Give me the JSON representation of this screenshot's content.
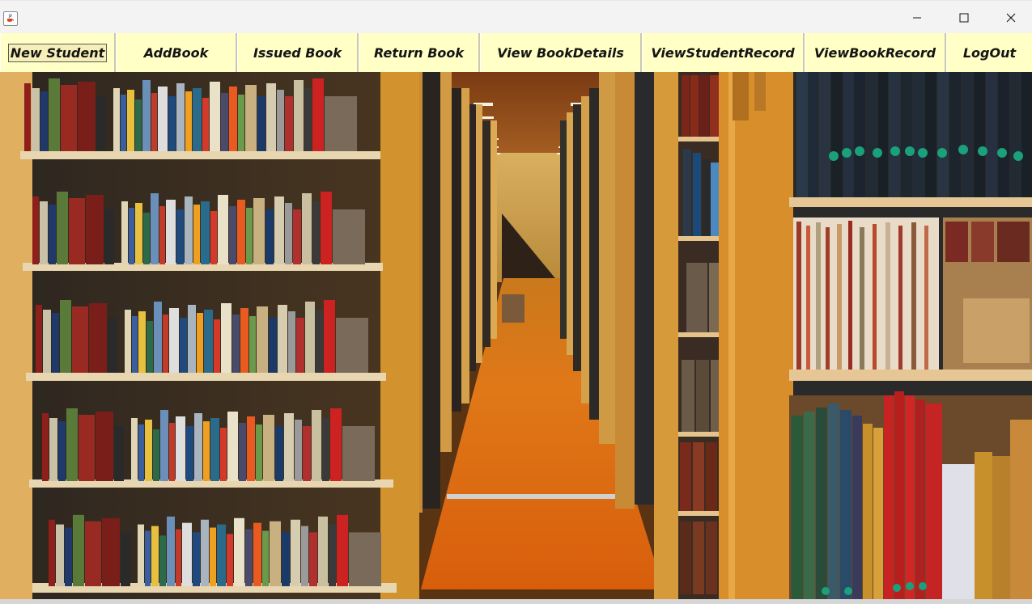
{
  "window": {
    "app_icon": "java-cup-icon",
    "controls": {
      "minimize": "minimize-icon",
      "maximize": "maximize-icon",
      "close": "close-icon"
    }
  },
  "menu": {
    "new_student": "New Student",
    "add_book": "AddBook",
    "issued_book": "Issued Book",
    "return_book": "Return Book",
    "view_book_details": "View BookDetails",
    "view_student_record": "ViewStudentRecord",
    "view_book_record": "ViewBookRecord",
    "logout": "LogOut"
  },
  "background": {
    "subject": "library-aisle-photo"
  },
  "colors": {
    "menubar": "#ffffc6",
    "titlebar": "#f3f3f3",
    "carpet": "#d8630e",
    "shelf_wood": "#d89a3e"
  }
}
